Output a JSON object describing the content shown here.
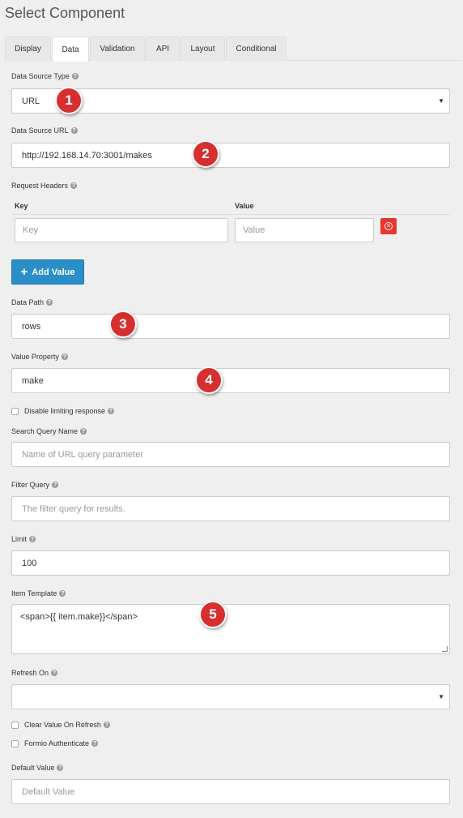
{
  "title": "Select Component",
  "tabs": [
    "Display",
    "Data",
    "Validation",
    "API",
    "Layout",
    "Conditional"
  ],
  "active_tab": "Data",
  "help_glyph": "?",
  "data_source_type": {
    "label": "Data Source Type",
    "value": "URL"
  },
  "data_source_url": {
    "label": "Data Source URL",
    "value": "http://192.168.14.70:3001/makes"
  },
  "request_headers": {
    "label": "Request Headers",
    "key_header": "Key",
    "value_header": "Value",
    "key_placeholder": "Key",
    "value_placeholder": "Value",
    "delete_icon": "remove-circle-icon",
    "add_label": "Add Value"
  },
  "data_path": {
    "label": "Data Path",
    "value": "rows"
  },
  "value_property": {
    "label": "Value Property",
    "value": "make"
  },
  "disable_limiting": {
    "label": "Disable limiting response",
    "checked": false
  },
  "search_query_name": {
    "label": "Search Query Name",
    "placeholder": "Name of URL query parameter"
  },
  "filter_query": {
    "label": "Filter Query",
    "placeholder": "The filter query for results."
  },
  "limit": {
    "label": "Limit",
    "value": "100"
  },
  "item_template": {
    "label": "Item Template",
    "value": "<span>{{ item.make}}</span>"
  },
  "refresh_on": {
    "label": "Refresh On",
    "value": ""
  },
  "clear_value_on_refresh": {
    "label": "Clear Value On Refresh",
    "checked": false
  },
  "formio_authenticate": {
    "label": "Formio Authenticate",
    "checked": false
  },
  "default_value": {
    "label": "Default Value",
    "placeholder": "Default Value"
  },
  "callouts": [
    "1",
    "2",
    "3",
    "4",
    "5"
  ],
  "colors": {
    "callout": "#d62f2f",
    "add_button": "#2a8fc9",
    "delete_button": "#e5382e"
  }
}
